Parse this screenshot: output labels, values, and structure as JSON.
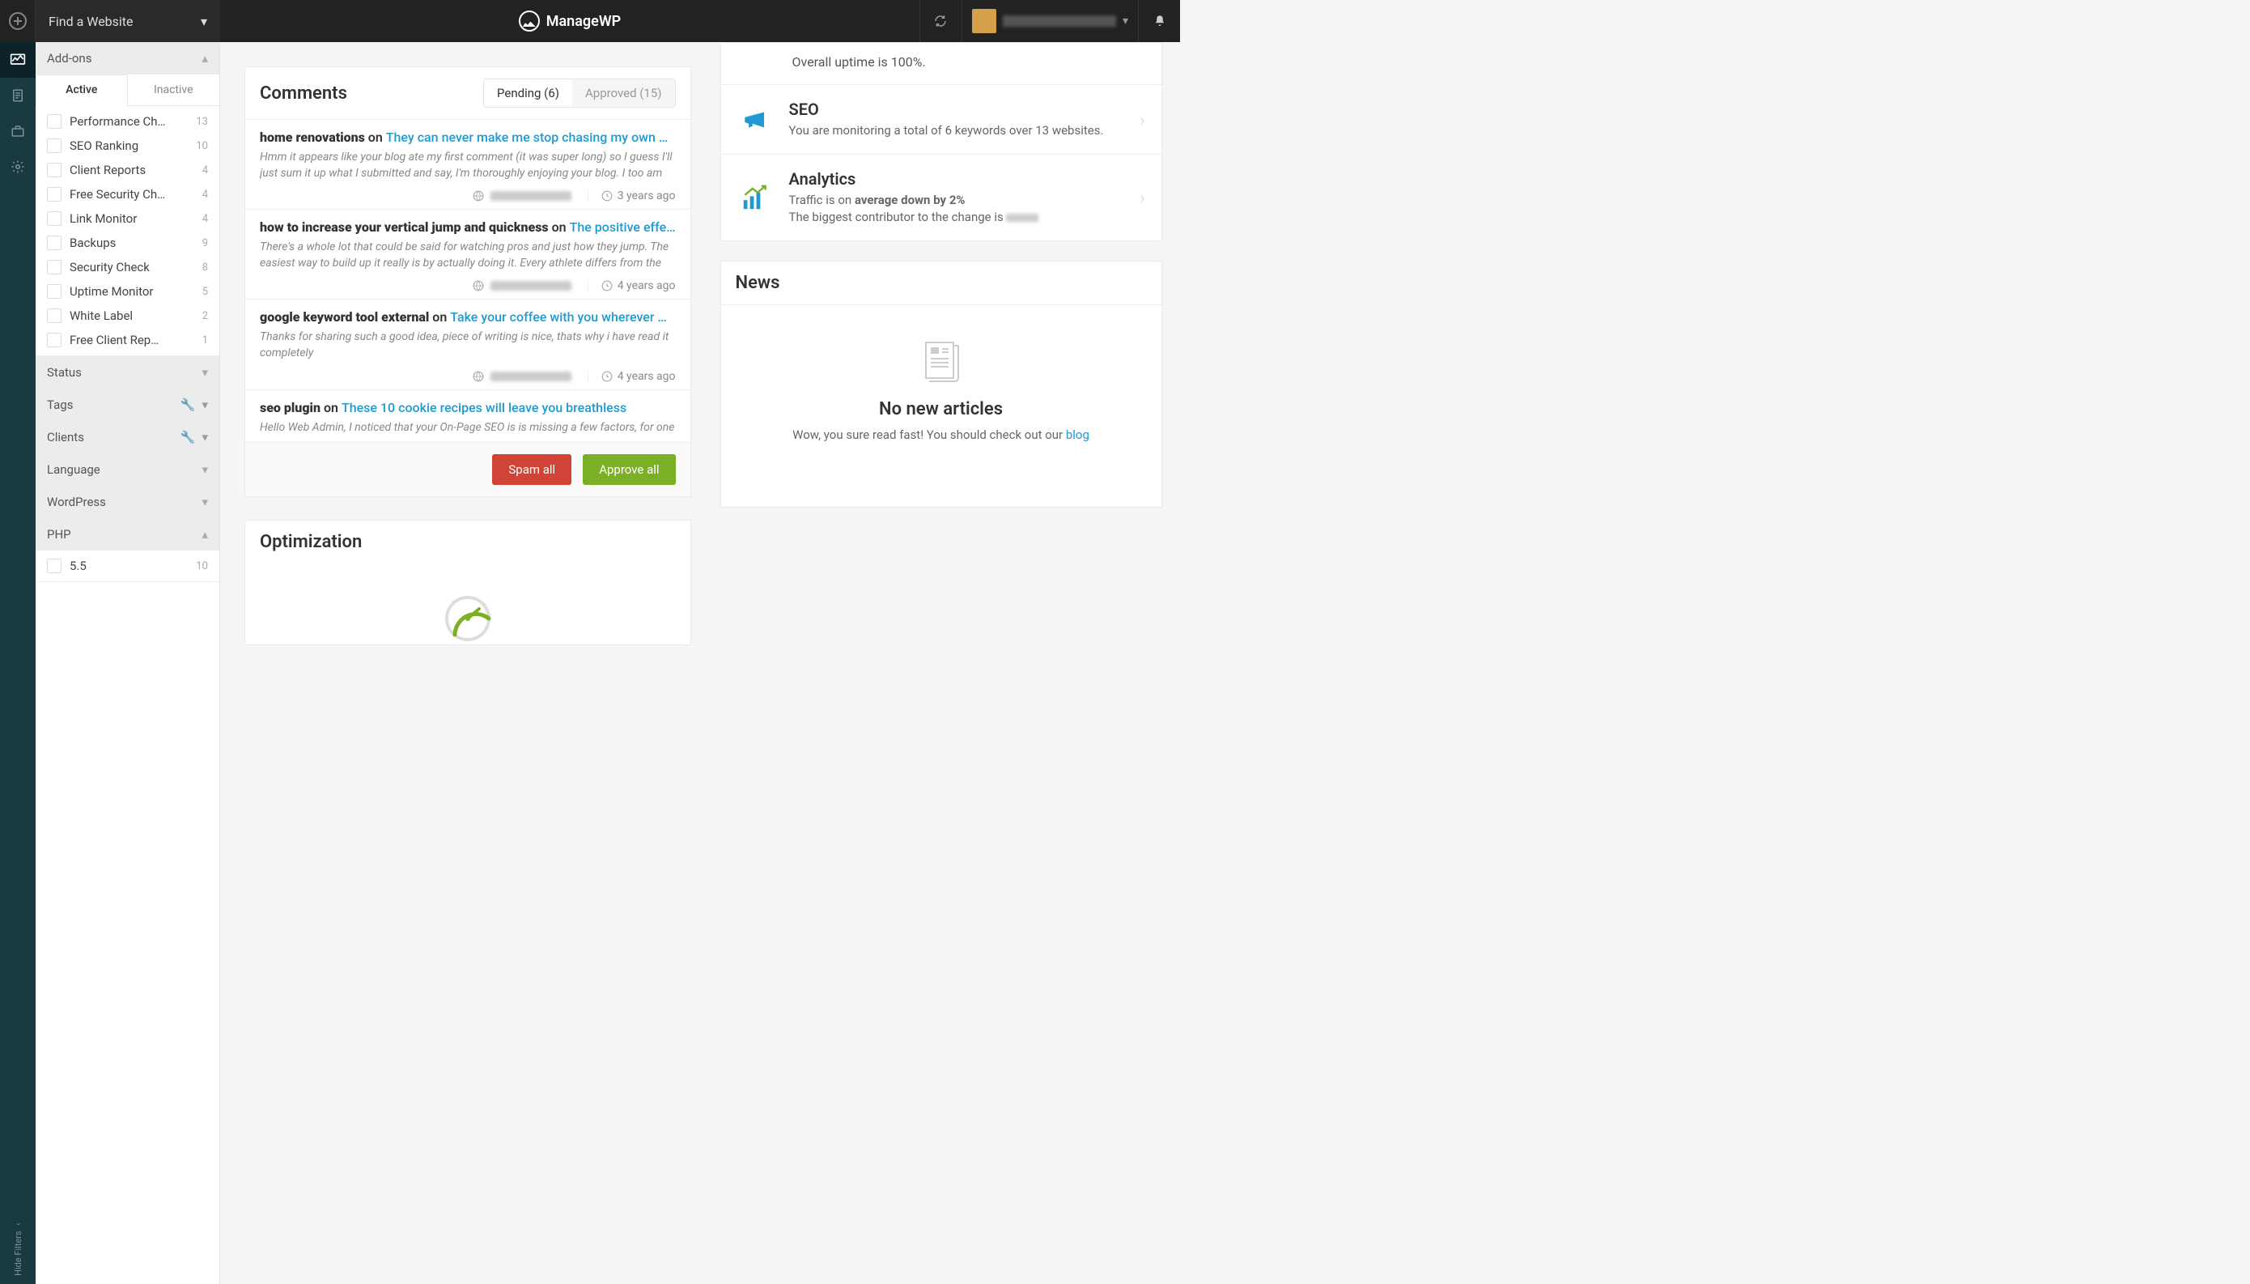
{
  "header": {
    "find_website": "Find a Website",
    "brand": "ManageWP"
  },
  "sidebar": {
    "sections": {
      "addons": {
        "label": "Add-ons",
        "tabs": {
          "active": "Active",
          "inactive": "Inactive"
        },
        "items": [
          {
            "label": "Performance Ch…",
            "count": "13"
          },
          {
            "label": "SEO Ranking",
            "count": "10"
          },
          {
            "label": "Client Reports",
            "count": "4"
          },
          {
            "label": "Free Security Ch…",
            "count": "4"
          },
          {
            "label": "Link Monitor",
            "count": "4"
          },
          {
            "label": "Backups",
            "count": "9"
          },
          {
            "label": "Security Check",
            "count": "8"
          },
          {
            "label": "Uptime Monitor",
            "count": "5"
          },
          {
            "label": "White Label",
            "count": "2"
          },
          {
            "label": "Free Client Rep…",
            "count": "1"
          }
        ]
      },
      "status": {
        "label": "Status"
      },
      "tags": {
        "label": "Tags"
      },
      "clients": {
        "label": "Clients"
      },
      "language": {
        "label": "Language"
      },
      "wordpress": {
        "label": "WordPress"
      },
      "php": {
        "label": "PHP",
        "items": [
          {
            "label": "5.5",
            "count": "10"
          }
        ]
      }
    },
    "hide_filters": "Hide Filters"
  },
  "comments": {
    "title": "Comments",
    "tabs": {
      "pending": "Pending (6)",
      "approved": "Approved (15)"
    },
    "items": [
      {
        "author": "home renovations",
        "on": " on ",
        "post": "They can never make me stop chasing my own …",
        "body": "Hmm it appears like your blog ate my first comment (it was super long) so I guess I'll just sum it up what I submitted and say, I'm thoroughly enjoying your blog. I too am",
        "time": "3 years ago"
      },
      {
        "author": "how to increase your vertical jump and quickness",
        "on": " on ",
        "post": "The positive effe…",
        "body": "There's a whole lot that could be said for watching pros and just how they jump. The easiest way to build up it really is by actually doing it. Every athlete differs from the",
        "time": "4 years ago"
      },
      {
        "author": "google keyword tool external",
        "on": " on ",
        "post": "Take your coffee with you wherever …",
        "body": "Thanks for sharing such a good idea, piece of writing is nice, thats why i have read it completely",
        "time": "4 years ago"
      },
      {
        "author": "seo plugin",
        "on": " on ",
        "post": "These 10 cookie recipes will leave you breathless",
        "body": "Hello Web Admin, I noticed that your On-Page SEO is is missing a few factors, for one",
        "time": ""
      }
    ],
    "actions": {
      "spam": "Spam all",
      "approve": "Approve all"
    }
  },
  "optimization": {
    "title": "Optimization"
  },
  "widgets": {
    "uptime_text": "Overall uptime is 100%.",
    "seo": {
      "title": "SEO",
      "desc": "You are monitoring a total of 6 keywords over 13 websites."
    },
    "analytics": {
      "title": "Analytics",
      "line1_pre": "Traffic is on ",
      "line1_bold": "average down by 2%",
      "line2": "The biggest contributor to the change is "
    }
  },
  "news": {
    "title": "News",
    "empty_title": "No new articles",
    "empty_text": "Wow, you sure read fast! You should check out our ",
    "link": "blog"
  }
}
